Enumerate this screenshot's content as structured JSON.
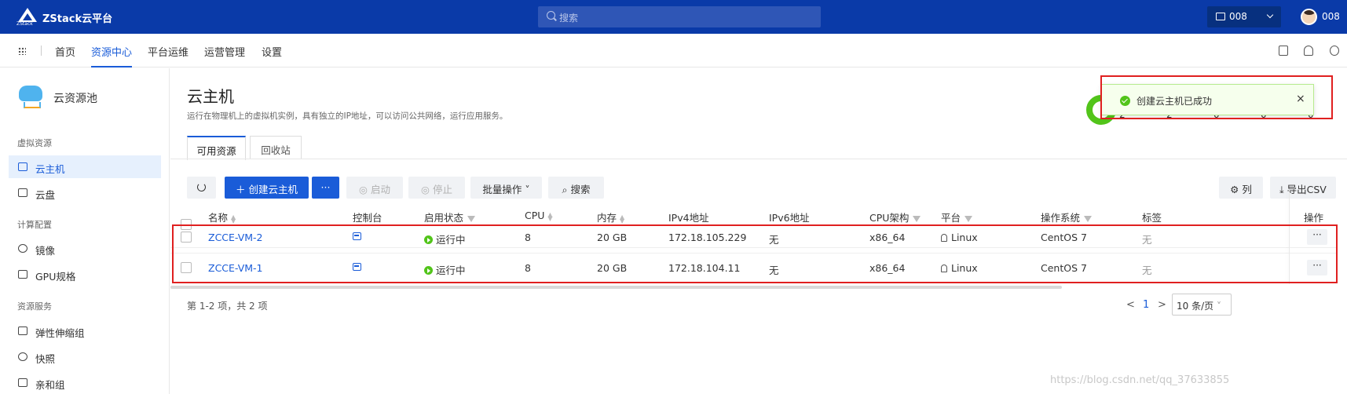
{
  "topbar": {
    "logo_text": "ZStack",
    "brand": "ZStack云平台",
    "search_placeholder": "搜索",
    "project": "008",
    "username": "008"
  },
  "nav": {
    "items": [
      "首页",
      "资源中心",
      "平台运维",
      "运营管理",
      "设置"
    ],
    "active": "资源中心"
  },
  "sidebar": {
    "title": "云资源池",
    "groups": [
      {
        "title": "虚拟资源",
        "items": [
          "云主机",
          "云盘"
        ]
      },
      {
        "title": "计算配置",
        "items": [
          "镜像",
          "GPU规格"
        ]
      },
      {
        "title": "资源服务",
        "items": [
          "弹性伸缩组",
          "快照",
          "亲和组"
        ]
      }
    ],
    "active_item": "云主机"
  },
  "page": {
    "title": "云主机",
    "description": "运行在物理机上的虚拟机实例，具有独立的IP地址，可以访问公共网络，运行应用服务。",
    "stat_values": [
      "2",
      "2",
      "0",
      "0",
      "0"
    ]
  },
  "toast": {
    "message": "创建云主机已成功",
    "close": "×"
  },
  "tabs": [
    "可用资源",
    "回收站"
  ],
  "toolbar": {
    "create": "创建云主机",
    "more": "···",
    "start": "启动",
    "stop": "停止",
    "batch": "批量操作",
    "search": "搜索",
    "columns": "列",
    "export": "导出CSV"
  },
  "table": {
    "columns": [
      "名称",
      "控制台",
      "启用状态",
      "CPU",
      "内存",
      "IPv4地址",
      "IPv6地址",
      "CPU架构",
      "平台",
      "操作系统",
      "标签",
      "操作"
    ],
    "rows": [
      {
        "name": "ZCCE-VM-2",
        "status": "运行中",
        "cpu": "8",
        "memory": "20 GB",
        "ipv4": "172.18.105.229",
        "ipv6": "无",
        "arch": "x86_64",
        "platform": "Linux",
        "os": "CentOS 7",
        "tag": "无",
        "action": "···"
      },
      {
        "name": "ZCCE-VM-1",
        "status": "运行中",
        "cpu": "8",
        "memory": "20 GB",
        "ipv4": "172.18.104.11",
        "ipv6": "无",
        "arch": "x86_64",
        "platform": "Linux",
        "os": "CentOS 7",
        "tag": "无",
        "action": "···"
      }
    ]
  },
  "pagination": {
    "summary": "第 1-2 项，共 2 项",
    "prev": "<",
    "current": "1",
    "next": ">",
    "page_size": "10 条/页"
  },
  "watermark": "https://blog.csdn.net/qq_37633855",
  "colors": {
    "brand": "#0a3aa8",
    "accent": "#1a5cd8",
    "success": "#52c41a",
    "highlight": "#e02020"
  }
}
